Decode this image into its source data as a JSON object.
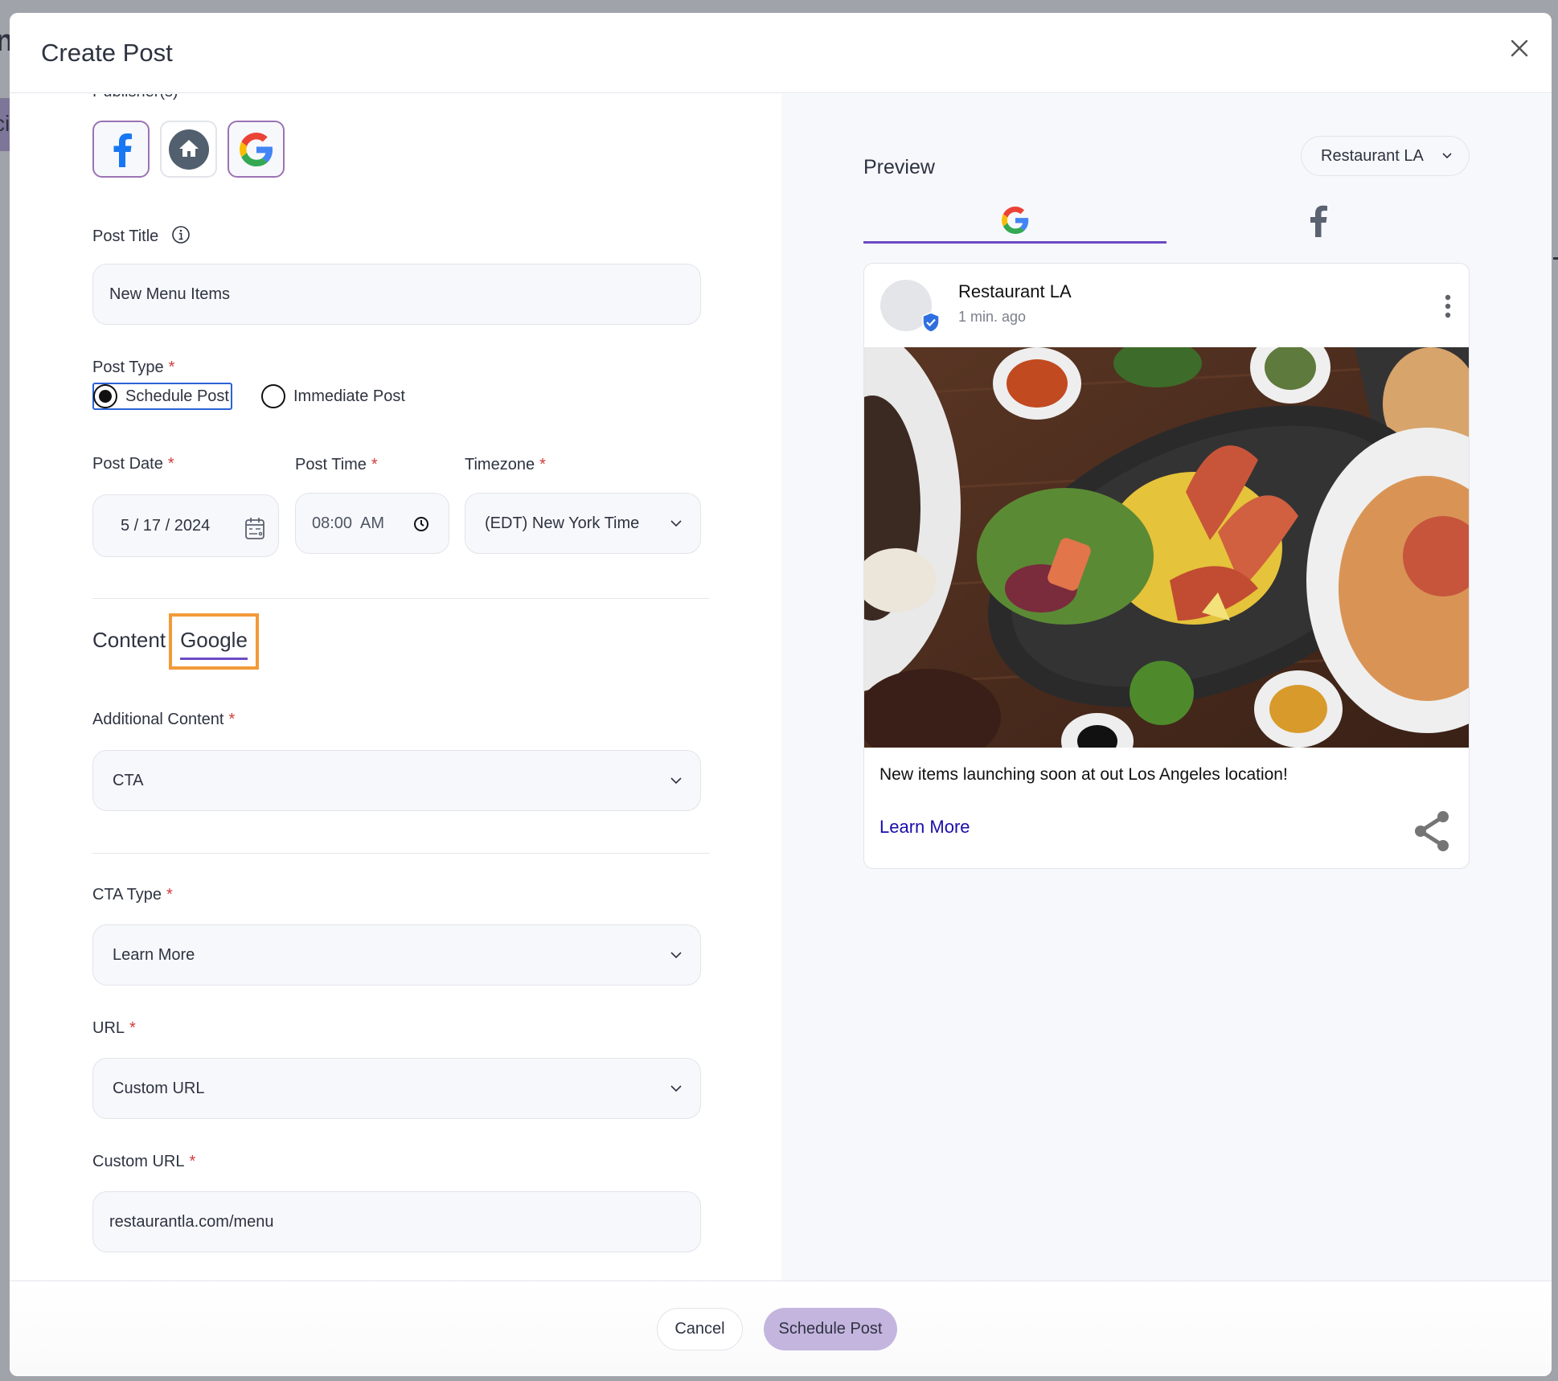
{
  "background": {
    "left_fragment": "ci",
    "top_fragment": "nt"
  },
  "modal": {
    "title": "Create Post",
    "close_label": "×"
  },
  "form": {
    "publishers_label": "Publisher(s)",
    "publishers": [
      {
        "name": "Facebook",
        "icon": "facebook-icon",
        "selected": true
      },
      {
        "name": "Home",
        "icon": "home-icon",
        "selected": false
      },
      {
        "name": "Google",
        "icon": "google-icon",
        "selected": true
      }
    ],
    "post_title": {
      "label": "Post Title",
      "value": "New Menu Items"
    },
    "post_type": {
      "label": "Post Type",
      "required": "*",
      "options": [
        {
          "label": "Schedule Post",
          "checked": true
        },
        {
          "label": "Immediate Post",
          "checked": false
        }
      ]
    },
    "post_date": {
      "label": "Post Date",
      "required": "*",
      "value": "5 / 17 / 2024"
    },
    "post_time": {
      "label": "Post Time",
      "required": "*",
      "value": "08:00  AM"
    },
    "timezone": {
      "label": "Timezone",
      "required": "*",
      "value": "(EDT) New York Time"
    },
    "tabs": [
      {
        "label": "Content",
        "active": false
      },
      {
        "label": "Google",
        "active": true
      }
    ],
    "additional_content": {
      "label": "Additional Content",
      "required": "*",
      "value": "CTA"
    },
    "cta_type": {
      "label": "CTA Type",
      "required": "*",
      "value": "Learn More"
    },
    "url": {
      "label": "URL",
      "required": "*",
      "value": "Custom URL"
    },
    "custom_url": {
      "label": "Custom URL",
      "required": "*",
      "value": "restaurantla.com/menu"
    }
  },
  "preview": {
    "title": "Preview",
    "location": "Restaurant LA",
    "tabs": [
      {
        "platform": "Google",
        "icon": "google-icon",
        "active": true
      },
      {
        "platform": "Facebook",
        "icon": "facebook-icon",
        "active": false
      }
    ],
    "card": {
      "name": "Restaurant LA",
      "time": "1 min. ago",
      "image_alt": "Overhead view of grilled shrimp with yellow rice and salad on dark plates",
      "text": "New items launching soon at out Los Angeles location!",
      "cta": "Learn More"
    }
  },
  "footer": {
    "cancel": "Cancel",
    "submit": "Schedule Post"
  },
  "colors": {
    "accent": "#6a4bc4",
    "primary_button": "#c4b5df",
    "focus_highlight": "#f29a38",
    "required": "#d23b3b",
    "link": "#1a0dab"
  }
}
